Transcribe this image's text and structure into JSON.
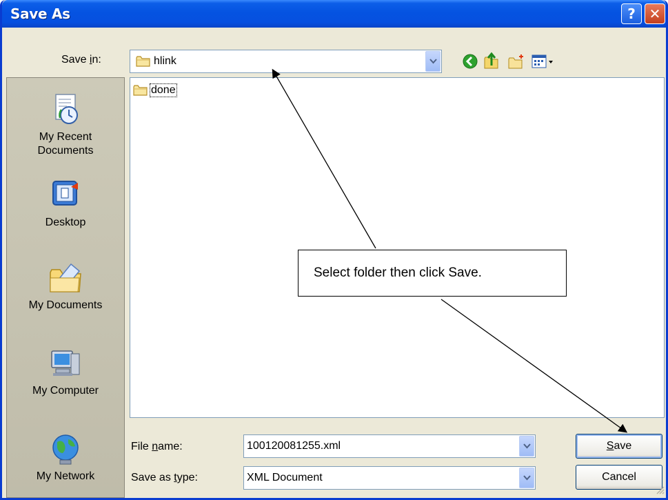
{
  "window": {
    "title": "Save As"
  },
  "titlebar_buttons": {
    "help": "?",
    "close": "✕"
  },
  "save_in": {
    "label_pre": "Save ",
    "label_key": "i",
    "label_post": "n:",
    "value": "hlink"
  },
  "toolbar": {
    "icons": [
      "back-icon",
      "up-folder-icon",
      "new-folder-icon",
      "views-menu-icon"
    ]
  },
  "places": [
    {
      "label": "My Recent\nDocuments",
      "icon": "recent-documents-icon"
    },
    {
      "label": "Desktop",
      "icon": "desktop-icon"
    },
    {
      "label": "My Documents",
      "icon": "my-documents-icon"
    },
    {
      "label": "My Computer",
      "icon": "my-computer-icon"
    },
    {
      "label": "My Network",
      "icon": "my-network-icon"
    }
  ],
  "file_list": {
    "items": [
      {
        "name": "done",
        "icon": "folder-icon"
      }
    ]
  },
  "file_name": {
    "label_pre": "File ",
    "label_key": "n",
    "label_post": "ame:",
    "value": "100120081255.xml"
  },
  "save_as_type": {
    "label_pre": "Save as ",
    "label_key": "t",
    "label_post": "ype:",
    "value": "XML Document"
  },
  "buttons": {
    "save_key": "S",
    "save_rest": "ave",
    "cancel": "Cancel"
  },
  "annotation": {
    "text": "Select folder then click Save."
  },
  "colors": {
    "title_bar": "#0553e1",
    "dialog_bg": "#ece9d8",
    "close_button": "#c4401f"
  }
}
